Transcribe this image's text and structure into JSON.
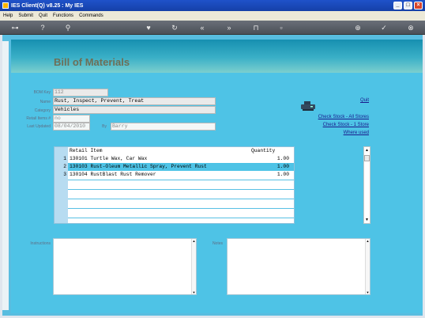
{
  "window": {
    "title": "IES Client(Q) v8.25 : My IES"
  },
  "menu": [
    "Help",
    "Submit",
    "Quit",
    "Functions",
    "Commands"
  ],
  "toolbar_icons": [
    "key-icon",
    "help-icon",
    "search-icon",
    "heart-icon",
    "refresh-icon",
    "rewind-icon",
    "fast-forward-icon",
    "trash-icon",
    "square-icon",
    "plus-icon",
    "check-icon",
    "close-icon"
  ],
  "page": {
    "title": "Bill of Materials"
  },
  "form": {
    "bom_key_label": "BOM Key",
    "bom_key": "112",
    "name_label": "Name",
    "name": "Rust, Inspect, Prevent, Treat",
    "category_label": "Category",
    "category": "Vehicles",
    "retail_count_label": "Retail Items #",
    "retail_count": "no",
    "last_updated_label": "Last Updated",
    "last_updated": "08/04/2010",
    "by_label": "By",
    "by": "Barry"
  },
  "links": {
    "quit": "Quit",
    "check_all": "Check Stock - All Stores",
    "check_one": "Check Stock - 1 Store",
    "where_used": "Where used"
  },
  "grid": {
    "columns": [
      "Retail Item",
      "Quantity"
    ],
    "rows": [
      {
        "n": "1",
        "item": "130101 Turtle Wax, Car Wax",
        "qty": "1.00"
      },
      {
        "n": "2",
        "item": "130103 Rust-Oleum Metallic Spray, Prevent Rust",
        "qty": "1.00"
      },
      {
        "n": "3",
        "item": "130104 RustBlast Rust Remover",
        "qty": "1.00"
      }
    ]
  },
  "memos": {
    "instructions_label": "Instructions",
    "notes_label": "Notes"
  },
  "colors": {
    "title_bar": "#1f52c9",
    "workspace": "#4ec3e6",
    "header": "#168fb0",
    "selected_row": "#4ec3e6"
  }
}
